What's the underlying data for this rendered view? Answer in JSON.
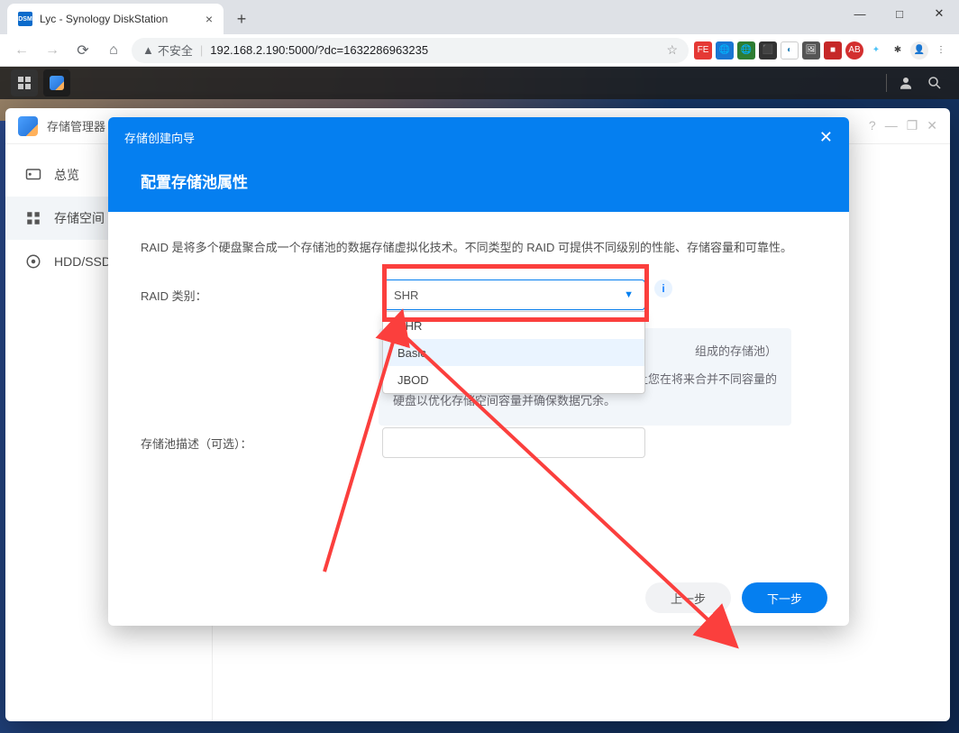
{
  "browser": {
    "tab_title": "Lyc - Synology DiskStation",
    "tab_favicon": "DSM",
    "insecure_label": "不安全",
    "url": "192.168.2.190:5000/?dc=1632286963235"
  },
  "storage_manager": {
    "title": "存储管理器",
    "sidebar": {
      "items": [
        {
          "label": "总览"
        },
        {
          "label": "存储空间"
        },
        {
          "label": "HDD/SSD"
        }
      ]
    }
  },
  "wizard": {
    "header": "存储创建向导",
    "title": "配置存储池属性",
    "description": "RAID 是将多个硬盘聚合成一个存储池的数据存储虚拟化技术。不同类型的 RAID 可提供不同级别的性能、存储容量和可靠性。",
    "raid_label": "RAID 类别：",
    "raid_selected": "SHR",
    "raid_options": [
      "SHR",
      "Basic",
      "JBOD"
    ],
    "note_line1": "组成的存储池）",
    "note_line2": "让您在将来合并不同容量的硬盘以优化存储空间容量并确保数据冗余。",
    "desc_label": "存储池描述（可选）：",
    "desc_value": "",
    "prev_btn": "上一步",
    "next_btn": "下一步"
  }
}
